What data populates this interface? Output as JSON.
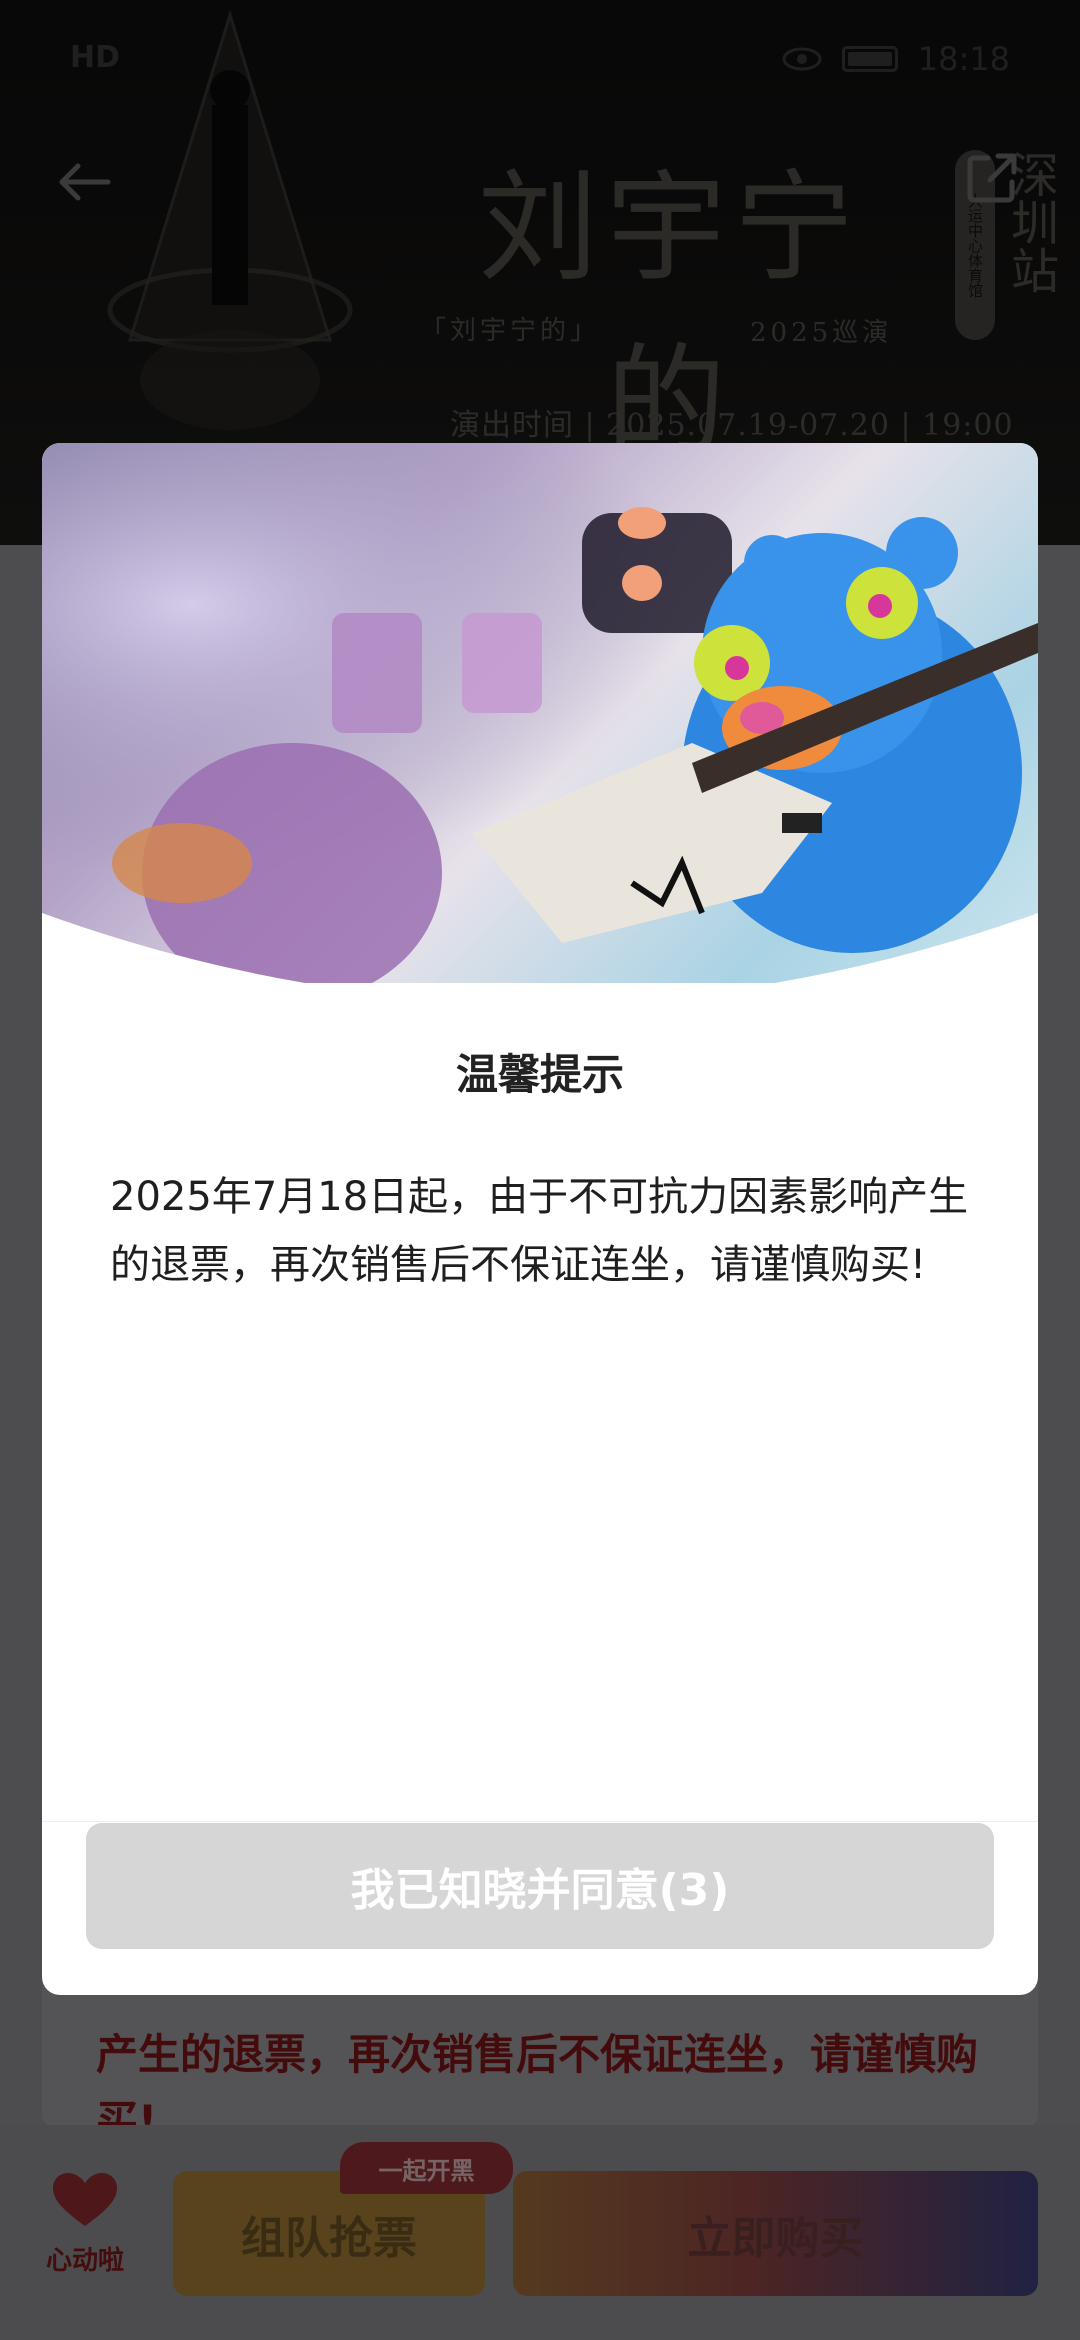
{
  "status_bar": {
    "carrier": "HD",
    "time": "18:18"
  },
  "poster": {
    "title": "刘宇宁的",
    "subtitle_left": "「刘宇宁的」",
    "subtitle_right": "2025巡演",
    "venue_badge": "大运中心体育馆",
    "city": "深圳站",
    "show_time": "演出时间 | 2025.07.19-07.20 | 19:00"
  },
  "modal": {
    "title": "温馨提示",
    "body": "2025年7月18日起，由于不可抗力因素影响产生的退票，再次销售后不保证连坐，请谨慎购买!",
    "agree_button": "我已知晓并同意(3)"
  },
  "background_notice": {
    "text": "产生的退票，再次销售后不保证连坐，请谨慎购买!"
  },
  "bottom_bar": {
    "like_label": "心动啦",
    "team_tag": "一起开黑",
    "team_button": "组队抢票",
    "buy_button": "立即购买"
  },
  "colors": {
    "accent_red": "#e02f3a",
    "team_orange": "#f0a83a",
    "modal_button_disabled": "#d6d6d6"
  },
  "icons": [
    "back-arrow-icon",
    "share-icon",
    "heart-icon",
    "battery-icon",
    "eye-icon"
  ]
}
